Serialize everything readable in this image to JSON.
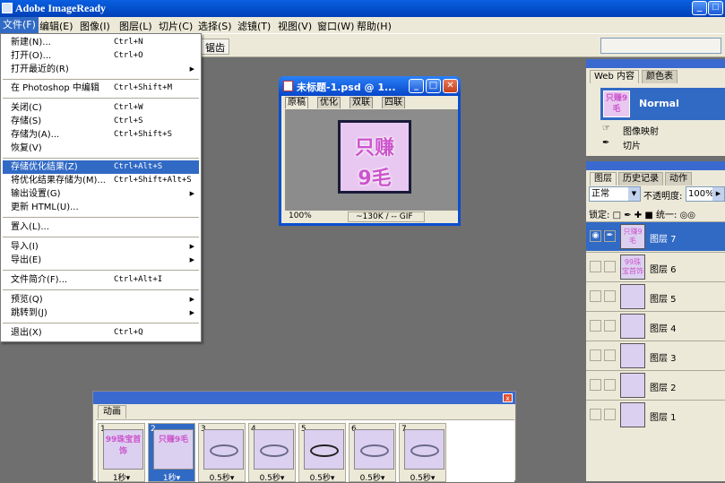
{
  "app": {
    "title": "Adobe ImageReady"
  },
  "titlebar_buttons": {
    "minimize": "_"
  },
  "menubar": [
    "文件(F)",
    "编辑(E)",
    "图像(I)",
    "图层(L)",
    "切片(C)",
    "选择(S)",
    "滤镜(T)",
    "视图(V)",
    "窗口(W)",
    "帮助(H)"
  ],
  "optbar": {
    "segment": "锯齿"
  },
  "file_menu": [
    {
      "label": "新建(N)...",
      "shortcut": "Ctrl+N"
    },
    {
      "label": "打开(O)...",
      "shortcut": "Ctrl+O"
    },
    {
      "label": "打开最近的(R)",
      "shortcut": "",
      "submenu": true
    },
    {
      "label": "在 Photoshop 中编辑",
      "shortcut": "Ctrl+Shift+M"
    },
    {
      "label": "关闭(C)",
      "shortcut": "Ctrl+W"
    },
    {
      "label": "存储(S)",
      "shortcut": "Ctrl+S"
    },
    {
      "label": "存储为(A)...",
      "shortcut": "Ctrl+Shift+S"
    },
    {
      "label": "恢复(V)",
      "shortcut": ""
    },
    {
      "label": "存储优化结果(Z)",
      "shortcut": "Ctrl+Alt+S",
      "highlight": true
    },
    {
      "label": "将优化结果存储为(M)...",
      "shortcut": "Ctrl+Shift+Alt+S"
    },
    {
      "label": "输出设置(G)",
      "shortcut": "",
      "submenu": true
    },
    {
      "label": "更新 HTML(U)...",
      "shortcut": ""
    },
    {
      "label": "置入(L)...",
      "shortcut": ""
    },
    {
      "label": "导入(I)",
      "shortcut": "",
      "submenu": true
    },
    {
      "label": "导出(E)",
      "shortcut": "",
      "submenu": true
    },
    {
      "label": "文件简介(F)...",
      "shortcut": "Ctrl+Alt+I"
    },
    {
      "label": "预览(Q)",
      "shortcut": "",
      "submenu": true
    },
    {
      "label": "跳转到(J)",
      "shortcut": "",
      "submenu": true
    },
    {
      "label": "退出(X)",
      "shortcut": "Ctrl+Q"
    }
  ],
  "image_window": {
    "title": "未标题-1.psd @ 1...",
    "tabs": [
      "原稿",
      "优化",
      "双联",
      "四联"
    ],
    "zoom": "100%",
    "size": "~130K / -- GIF",
    "pic_line1": "只赚",
    "pic_line2": "9毛"
  },
  "web_panel": {
    "tabs": [
      "Web 内容",
      "颜色表"
    ],
    "normal_label": "Normal",
    "thumb_text": "只赚9毛",
    "rows": [
      "图像映射",
      "切片"
    ]
  },
  "layers_panel": {
    "tabs": [
      "图层",
      "历史记录",
      "动作"
    ],
    "blend_mode": "正常",
    "opacity_label": "不透明度:",
    "opacity_value": "100%",
    "lock_label": "锁定:",
    "unify_label": "统一:",
    "layers": [
      {
        "name": "图层 7",
        "thumb": "只赚9毛",
        "selected": true
      },
      {
        "name": "图层 6",
        "thumb": "99珠宝首饰"
      },
      {
        "name": "图层 5",
        "thumb": ""
      },
      {
        "name": "图层 4",
        "thumb": ""
      },
      {
        "name": "图层 3",
        "thumb": ""
      },
      {
        "name": "图层 2",
        "thumb": ""
      },
      {
        "name": "图层 1",
        "thumb": ""
      }
    ]
  },
  "animation_panel": {
    "tab": "动画",
    "close": "x",
    "frames": [
      {
        "num": "1",
        "thumb": "99珠宝首饰",
        "delay": "1秒▾"
      },
      {
        "num": "2",
        "thumb": "只赚9毛",
        "delay": "1秒▾",
        "selected": true
      },
      {
        "num": "3",
        "thumb": "",
        "delay": "0.5秒▾"
      },
      {
        "num": "4",
        "thumb": "",
        "delay": "0.5秒▾"
      },
      {
        "num": "5",
        "thumb": "",
        "delay": "0.5秒▾"
      },
      {
        "num": "6",
        "thumb": "",
        "delay": "0.5秒▾"
      },
      {
        "num": "7",
        "thumb": "",
        "delay": "0.5秒▾"
      }
    ]
  }
}
